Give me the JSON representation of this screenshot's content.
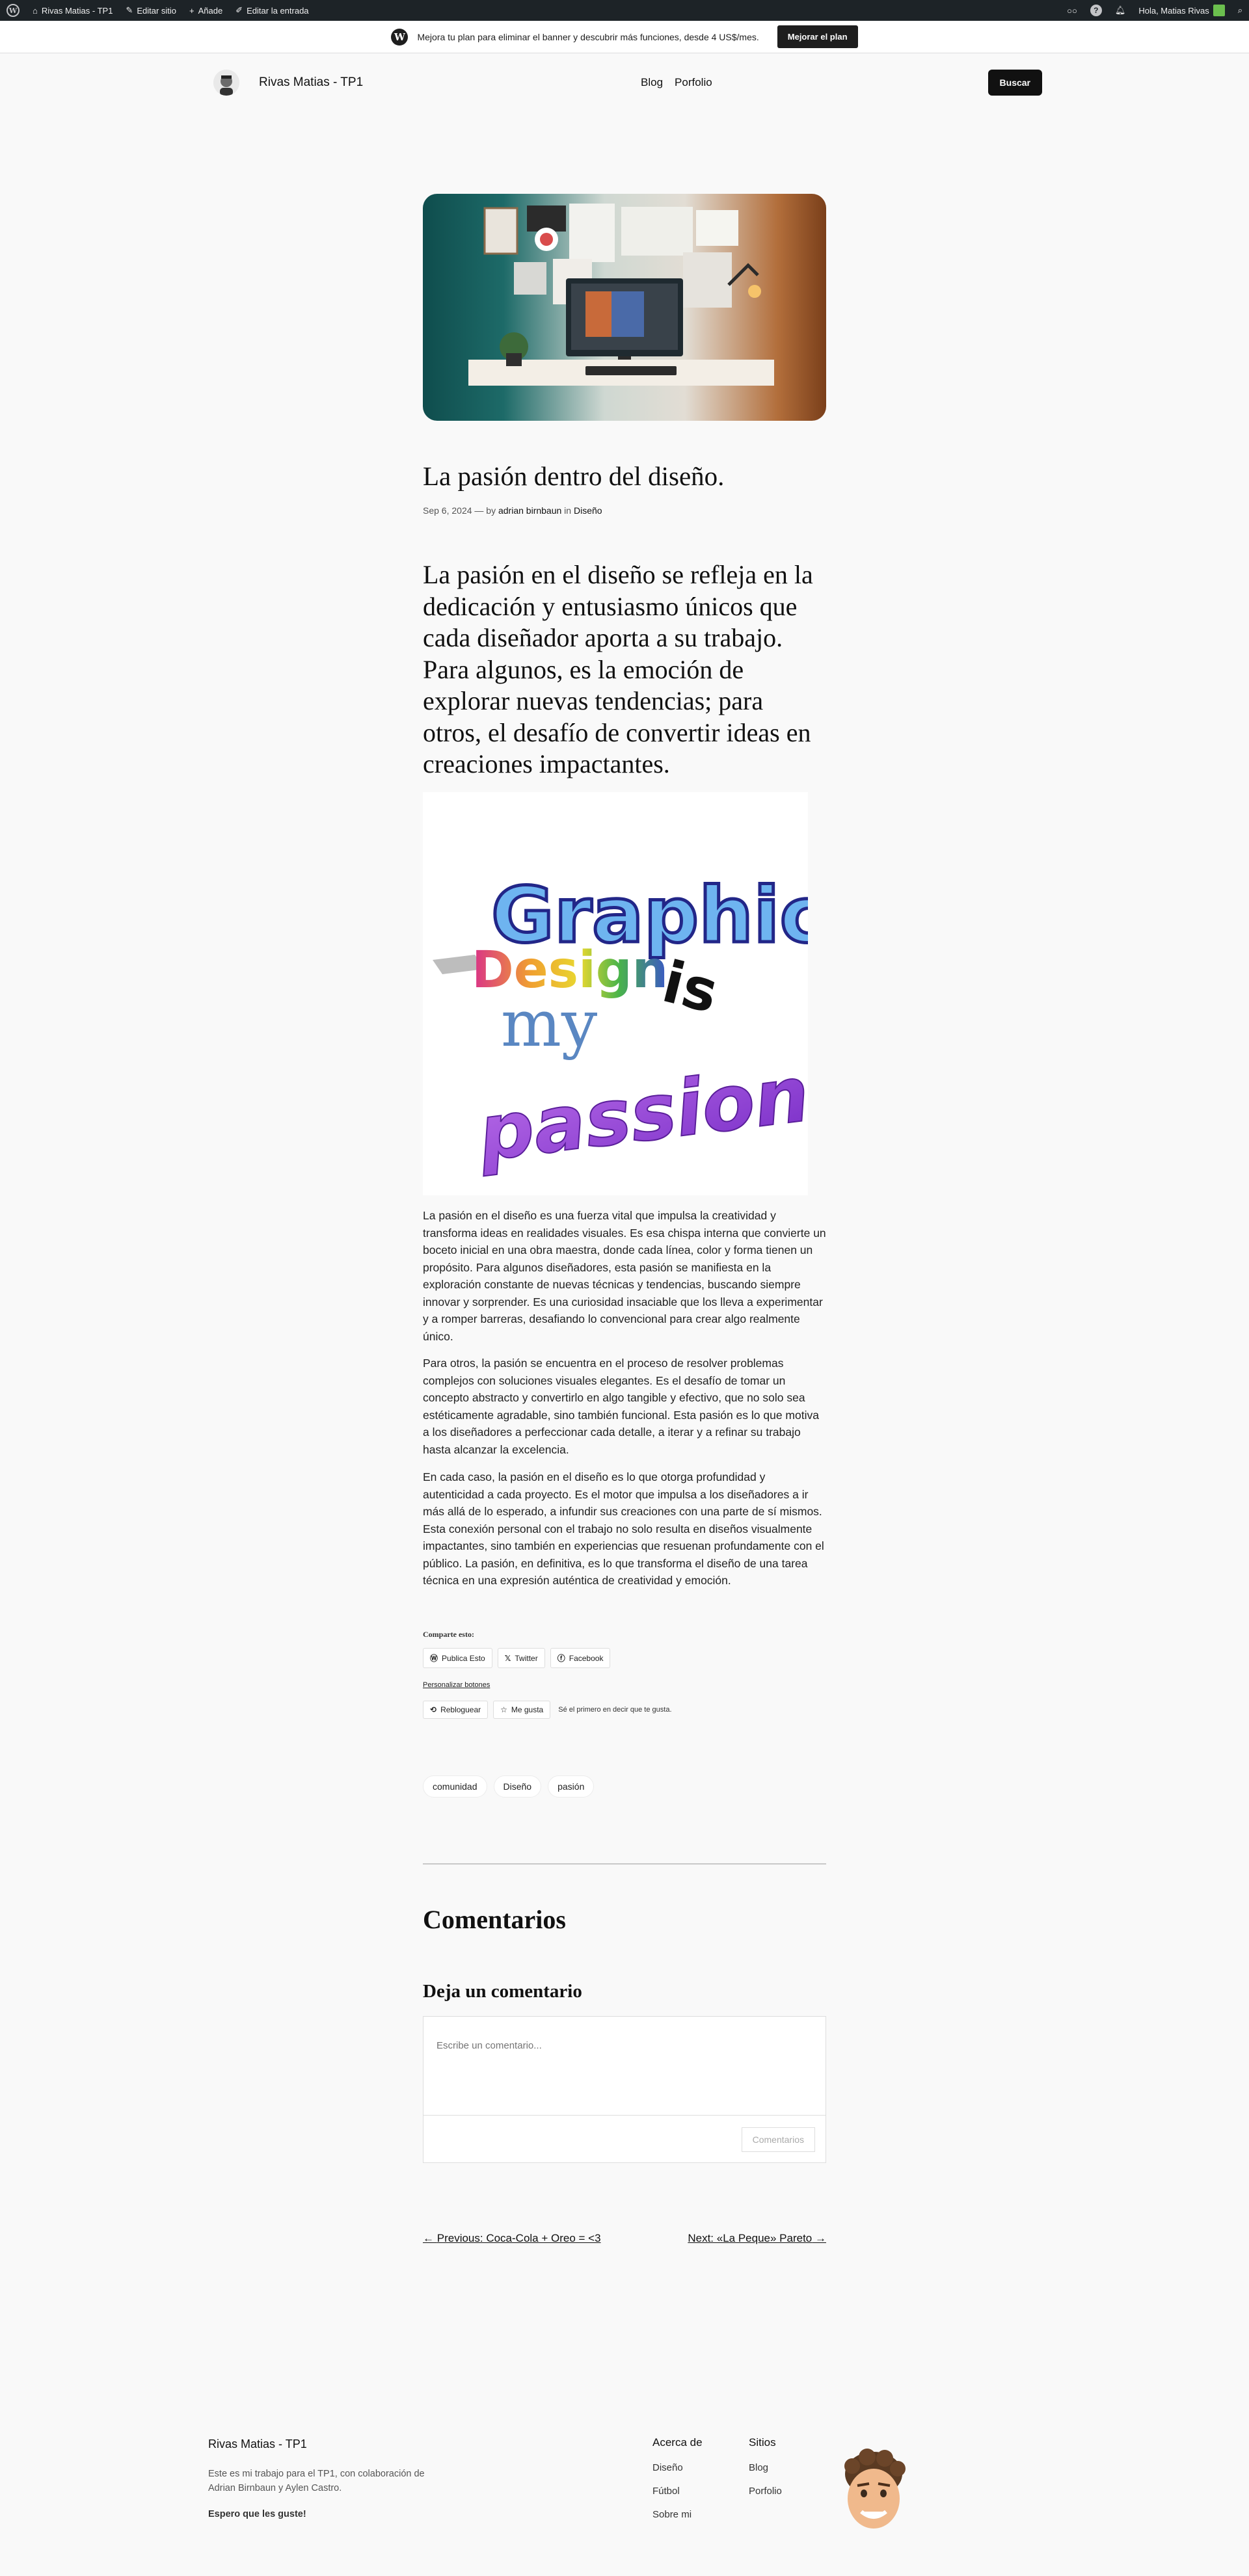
{
  "adminbar": {
    "site_name": "Rivas Matias - TP1",
    "edit_site": "Editar sitio",
    "add_new": "Añade",
    "edit_post": "Editar la entrada",
    "greeting": "Hola, Matias Rivas"
  },
  "banner": {
    "text": "Mejora tu plan para eliminar el banner y descubrir más funciones, desde 4 US$/mes.",
    "button": "Mejorar el plan"
  },
  "header": {
    "site_title": "Rivas Matias - TP1",
    "nav": [
      "Blog",
      "Porfolio"
    ],
    "search_label": "Buscar"
  },
  "post": {
    "title": "La pasión dentro del diseño.",
    "date": "Sep 6, 2024",
    "by": "— by",
    "author": "adrian birnbaun",
    "in": "in",
    "category": "Diseño",
    "lead": "La pasión en el diseño se refleja en la dedicación y entusiasmo únicos que cada diseñador aporta a su trabajo. Para algunos, es la emoción de explorar nuevas tendencias; para otros, el desafío de convertir ideas en creaciones impactantes.",
    "image_text": [
      "Graphic",
      "Design",
      "is",
      "my",
      "passion"
    ],
    "paragraphs": [
      "La pasión en el diseño es una fuerza vital que impulsa la creatividad y transforma ideas en realidades visuales. Es esa chispa interna que convierte un boceto inicial en una obra maestra, donde cada línea, color y forma tienen un propósito. Para algunos diseñadores, esta pasión se manifiesta en la exploración constante de nuevas técnicas y tendencias, buscando siempre innovar y sorprender. Es una curiosidad insaciable que los lleva a experimentar y a romper barreras, desafiando lo convencional para crear algo realmente único.",
      "Para otros, la pasión se encuentra en el proceso de resolver problemas complejos con soluciones visuales elegantes. Es el desafío de tomar un concepto abstracto y convertirlo en algo tangible y efectivo, que no solo sea estéticamente agradable, sino también funcional. Esta pasión es lo que motiva a los diseñadores a perfeccionar cada detalle, a iterar y a refinar su trabajo hasta alcanzar la excelencia.",
      "En cada caso, la pasión en el diseño es lo que otorga profundidad y autenticidad a cada proyecto. Es el motor que impulsa a los diseñadores a ir más allá de lo esperado, a infundir sus creaciones con una parte de sí mismos. Esta conexión personal con el trabajo no solo resulta en diseños visualmente impactantes, sino también en experiencias que resuenan profundamente con el público. La pasión, en definitiva, es lo que transforma el diseño de una tarea técnica en una expresión auténtica de creatividad y emoción."
    ]
  },
  "share": {
    "label": "Comparte esto:",
    "buttons": [
      "Publica Esto",
      "Twitter",
      "Facebook"
    ],
    "customize": "Personalizar botones",
    "reblog": "Rebloguear",
    "like": "Me gusta",
    "like_note": "Sé el primero en decir que te gusta."
  },
  "tags": [
    "comunidad",
    "Diseño",
    "pasión"
  ],
  "comments": {
    "heading": "Comentarios",
    "leave": "Deja un comentario",
    "placeholder": "Escribe un comentario...",
    "submit": "Comentarios"
  },
  "postnav": {
    "prev": "Previous: Coca-Cola + Oreo = <3",
    "next": "Next: «La Peque» Pareto"
  },
  "footer": {
    "title": "Rivas Matias - TP1",
    "desc": "Este es mi trabajo para el TP1, con colaboración de Adrian Birnbaun y Aylen Castro.",
    "bold": "Espero que les guste!",
    "col1_title": "Acerca de",
    "col1": [
      "Diseño",
      "Fútbol",
      "Sobre mi"
    ],
    "col2_title": "Sitios",
    "col2": [
      "Blog",
      "Porfolio"
    ]
  }
}
